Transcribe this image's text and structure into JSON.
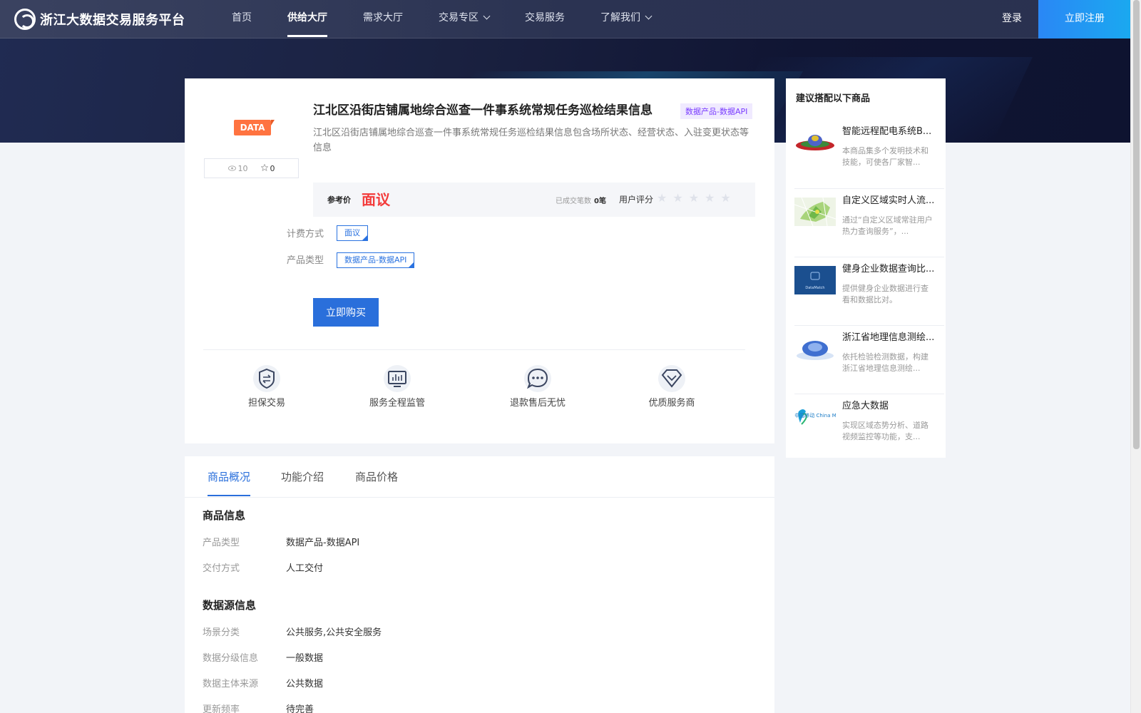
{
  "header": {
    "logo_text": "浙江大数据交易服务平台",
    "nav": [
      "首页",
      "供给大厅",
      "需求大厅",
      "交易专区",
      "交易服务",
      "了解我们"
    ],
    "login": "登录",
    "register": "立即注册"
  },
  "product": {
    "badge": "DATA",
    "views": "10",
    "favorites": "0",
    "title": "江北区沿街店铺属地综合巡查一件事系统常规任务巡检结果信息",
    "type_tag": "数据产品-数据API",
    "description": "江北区沿街店铺属地综合巡查一件事系统常规任务巡检结果信息包含场所状态、经营状态、入驻变更状态等信息",
    "price_label": "参考价",
    "price_value": "面议",
    "deals_label": "已成交笔数",
    "deals_value": "0笔",
    "rating_label": "用户评分",
    "rating_value": 0,
    "billing_label": "计费方式",
    "billing_value": "面议",
    "category_label": "产品类型",
    "category_value": "数据产品-数据API",
    "buy_button": "立即购买"
  },
  "guarantees": [
    "担保交易",
    "服务全程监管",
    "退款售后无忧",
    "优质服务商"
  ],
  "tabs": [
    "商品概况",
    "功能介绍",
    "商品价格"
  ],
  "info": {
    "section1_title": "商品信息",
    "product_type_k": "产品类型",
    "product_type_v": "数据产品-数据API",
    "delivery_k": "交付方式",
    "delivery_v": "人工交付",
    "section2_title": "数据源信息",
    "scene_k": "场景分类",
    "scene_v": "公共服务,公共安全服务",
    "level_k": "数据分级信息",
    "level_v": "一般数据",
    "source_k": "数据主体来源",
    "source_v": "公共数据",
    "freq_k": "更新频率",
    "freq_v": "待完善"
  },
  "sidebar": {
    "title": "建议搭配以下商品",
    "items": [
      {
        "name": "智能远程配电系统B...",
        "desc": "本商品集多个发明技术和技能，可使各厂家智...",
        "thumb": "ufo-image"
      },
      {
        "name": "自定义区域实时人流...",
        "desc": "通过“自定义区域常驻用户热力查询服务”，...",
        "thumb": "map-image"
      },
      {
        "name": "健身企业数据查询比...",
        "desc": "提供健身企业数据进行查看和数据比对。",
        "thumb": "datamatch-image",
        "thumb_label": "DataMatch"
      },
      {
        "name": "浙江省地理信息测绘...",
        "desc": "依托检验检测数据，构建浙江省地理信息测绘...",
        "thumb": "globe-image"
      },
      {
        "name": "应急大数据",
        "desc": "实现区域态势分析、道路视频监控等功能，支...",
        "thumb": "china-mobile-logo",
        "thumb_label": "中国移动 China Mobile"
      }
    ]
  },
  "colors": {
    "primary": "#2a6fdb",
    "price_red": "#f33b3b",
    "badge_orange": "#ff7340",
    "tag_purple": "#7a3cff"
  }
}
